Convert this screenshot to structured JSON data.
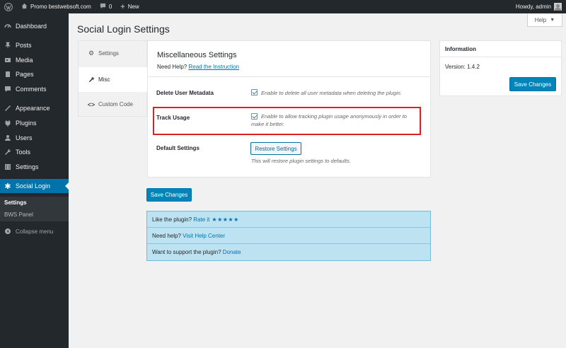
{
  "adminbar": {
    "site_name": "Promo bestwebsoft.com",
    "comments_count": "0",
    "new_label": "New",
    "howdy": "Howdy, admin"
  },
  "sidebar": {
    "items": [
      {
        "label": "Dashboard",
        "icon": "dashboard-icon"
      },
      {
        "label": "Posts",
        "icon": "pin-icon"
      },
      {
        "label": "Media",
        "icon": "media-icon"
      },
      {
        "label": "Pages",
        "icon": "page-icon"
      },
      {
        "label": "Comments",
        "icon": "comment-icon"
      },
      {
        "label": "Appearance",
        "icon": "brush-icon"
      },
      {
        "label": "Plugins",
        "icon": "plug-icon"
      },
      {
        "label": "Users",
        "icon": "users-icon"
      },
      {
        "label": "Tools",
        "icon": "wrench-icon"
      },
      {
        "label": "Settings",
        "icon": "sliders-icon"
      },
      {
        "label": "Social Login",
        "icon": "snowflake-icon"
      }
    ],
    "submenu": [
      "Settings",
      "BWS Panel"
    ],
    "collapse_label": "Collapse menu"
  },
  "page": {
    "title": "Social Login Settings",
    "help_button": "Help"
  },
  "tabs": [
    {
      "label": "Settings",
      "icon": "gear-icon"
    },
    {
      "label": "Misc",
      "icon": "wrench-icon"
    },
    {
      "label": "Custom Code",
      "icon": "code-icon"
    }
  ],
  "panel": {
    "title": "Miscellaneous Settings",
    "need_help": "Need Help?",
    "instruction_link": "Read the Instruction",
    "rows": {
      "delete_meta": {
        "label": "Delete User Metadata",
        "desc": "Enable to delete all user metadata when deleting the plugin.",
        "checked": true
      },
      "track_usage": {
        "label": "Track Usage",
        "desc_line1": "Enable to allow tracking plugin usage anonymously in order to",
        "desc_line2": "make it better.",
        "checked": true
      },
      "default_settings": {
        "label": "Default Settings",
        "button": "Restore Settings",
        "desc": "This will restore plugin settings to defaults."
      }
    }
  },
  "save_changes": "Save Changes",
  "info": {
    "title": "Information",
    "version": "Version: 1.4.2",
    "save_changes": "Save Changes"
  },
  "notice": {
    "like_text": "Like the plugin?",
    "rate_link": "Rate it",
    "stars": "★★★★★",
    "help_text": "Need help?",
    "help_link": "Visit Help Center",
    "support_text": "Want to support the plugin?",
    "donate_link": "Donate"
  },
  "colors": {
    "admin_bg": "#23282d",
    "accent": "#0073aa",
    "primary_button": "#0085ba",
    "highlight": "#e02020",
    "notice_bg": "#bde3f3"
  }
}
